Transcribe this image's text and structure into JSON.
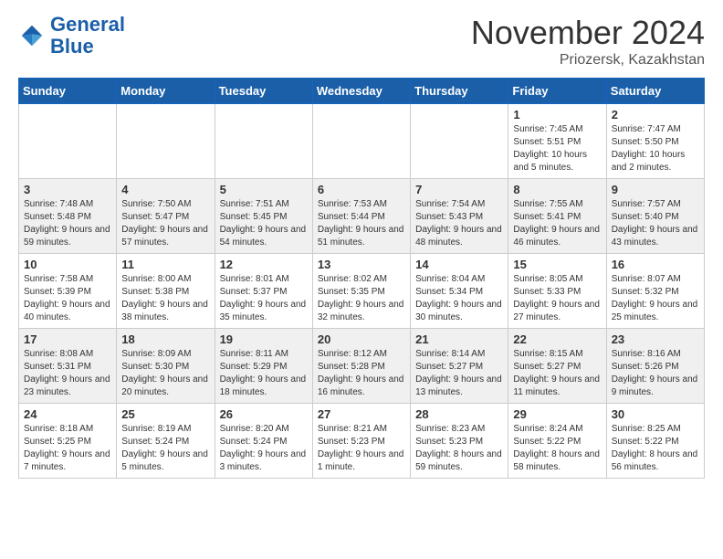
{
  "header": {
    "logo_line1": "General",
    "logo_line2": "Blue",
    "month_title": "November 2024",
    "location": "Priozersk, Kazakhstan"
  },
  "weekdays": [
    "Sunday",
    "Monday",
    "Tuesday",
    "Wednesday",
    "Thursday",
    "Friday",
    "Saturday"
  ],
  "weeks": [
    [
      {
        "day": "",
        "info": ""
      },
      {
        "day": "",
        "info": ""
      },
      {
        "day": "",
        "info": ""
      },
      {
        "day": "",
        "info": ""
      },
      {
        "day": "",
        "info": ""
      },
      {
        "day": "1",
        "info": "Sunrise: 7:45 AM\nSunset: 5:51 PM\nDaylight: 10 hours and 5 minutes."
      },
      {
        "day": "2",
        "info": "Sunrise: 7:47 AM\nSunset: 5:50 PM\nDaylight: 10 hours and 2 minutes."
      }
    ],
    [
      {
        "day": "3",
        "info": "Sunrise: 7:48 AM\nSunset: 5:48 PM\nDaylight: 9 hours and 59 minutes."
      },
      {
        "day": "4",
        "info": "Sunrise: 7:50 AM\nSunset: 5:47 PM\nDaylight: 9 hours and 57 minutes."
      },
      {
        "day": "5",
        "info": "Sunrise: 7:51 AM\nSunset: 5:45 PM\nDaylight: 9 hours and 54 minutes."
      },
      {
        "day": "6",
        "info": "Sunrise: 7:53 AM\nSunset: 5:44 PM\nDaylight: 9 hours and 51 minutes."
      },
      {
        "day": "7",
        "info": "Sunrise: 7:54 AM\nSunset: 5:43 PM\nDaylight: 9 hours and 48 minutes."
      },
      {
        "day": "8",
        "info": "Sunrise: 7:55 AM\nSunset: 5:41 PM\nDaylight: 9 hours and 46 minutes."
      },
      {
        "day": "9",
        "info": "Sunrise: 7:57 AM\nSunset: 5:40 PM\nDaylight: 9 hours and 43 minutes."
      }
    ],
    [
      {
        "day": "10",
        "info": "Sunrise: 7:58 AM\nSunset: 5:39 PM\nDaylight: 9 hours and 40 minutes."
      },
      {
        "day": "11",
        "info": "Sunrise: 8:00 AM\nSunset: 5:38 PM\nDaylight: 9 hours and 38 minutes."
      },
      {
        "day": "12",
        "info": "Sunrise: 8:01 AM\nSunset: 5:37 PM\nDaylight: 9 hours and 35 minutes."
      },
      {
        "day": "13",
        "info": "Sunrise: 8:02 AM\nSunset: 5:35 PM\nDaylight: 9 hours and 32 minutes."
      },
      {
        "day": "14",
        "info": "Sunrise: 8:04 AM\nSunset: 5:34 PM\nDaylight: 9 hours and 30 minutes."
      },
      {
        "day": "15",
        "info": "Sunrise: 8:05 AM\nSunset: 5:33 PM\nDaylight: 9 hours and 27 minutes."
      },
      {
        "day": "16",
        "info": "Sunrise: 8:07 AM\nSunset: 5:32 PM\nDaylight: 9 hours and 25 minutes."
      }
    ],
    [
      {
        "day": "17",
        "info": "Sunrise: 8:08 AM\nSunset: 5:31 PM\nDaylight: 9 hours and 23 minutes."
      },
      {
        "day": "18",
        "info": "Sunrise: 8:09 AM\nSunset: 5:30 PM\nDaylight: 9 hours and 20 minutes."
      },
      {
        "day": "19",
        "info": "Sunrise: 8:11 AM\nSunset: 5:29 PM\nDaylight: 9 hours and 18 minutes."
      },
      {
        "day": "20",
        "info": "Sunrise: 8:12 AM\nSunset: 5:28 PM\nDaylight: 9 hours and 16 minutes."
      },
      {
        "day": "21",
        "info": "Sunrise: 8:14 AM\nSunset: 5:27 PM\nDaylight: 9 hours and 13 minutes."
      },
      {
        "day": "22",
        "info": "Sunrise: 8:15 AM\nSunset: 5:27 PM\nDaylight: 9 hours and 11 minutes."
      },
      {
        "day": "23",
        "info": "Sunrise: 8:16 AM\nSunset: 5:26 PM\nDaylight: 9 hours and 9 minutes."
      }
    ],
    [
      {
        "day": "24",
        "info": "Sunrise: 8:18 AM\nSunset: 5:25 PM\nDaylight: 9 hours and 7 minutes."
      },
      {
        "day": "25",
        "info": "Sunrise: 8:19 AM\nSunset: 5:24 PM\nDaylight: 9 hours and 5 minutes."
      },
      {
        "day": "26",
        "info": "Sunrise: 8:20 AM\nSunset: 5:24 PM\nDaylight: 9 hours and 3 minutes."
      },
      {
        "day": "27",
        "info": "Sunrise: 8:21 AM\nSunset: 5:23 PM\nDaylight: 9 hours and 1 minute."
      },
      {
        "day": "28",
        "info": "Sunrise: 8:23 AM\nSunset: 5:23 PM\nDaylight: 8 hours and 59 minutes."
      },
      {
        "day": "29",
        "info": "Sunrise: 8:24 AM\nSunset: 5:22 PM\nDaylight: 8 hours and 58 minutes."
      },
      {
        "day": "30",
        "info": "Sunrise: 8:25 AM\nSunset: 5:22 PM\nDaylight: 8 hours and 56 minutes."
      }
    ]
  ]
}
